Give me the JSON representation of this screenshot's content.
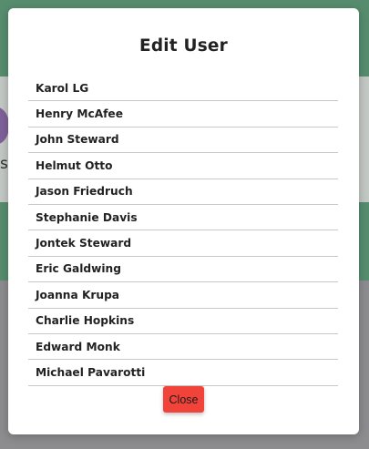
{
  "modal": {
    "title": "Edit User",
    "users": [
      "Karol LG",
      "Henry McAfee",
      "John Steward",
      "Helmut Otto",
      "Jason Friedruch",
      "Stephanie Davis",
      "Jontek Steward",
      "Eric Galdwing",
      "Joanna Krupa",
      "Charlie Hopkins",
      "Edward Monk",
      "Michael Pavarotti"
    ],
    "close_label": "Close"
  },
  "background": {
    "partial_text": "s"
  },
  "colors": {
    "accent_green": "#5f9a78",
    "close_button": "#f2433a",
    "avatar": "#8a6aa8"
  }
}
